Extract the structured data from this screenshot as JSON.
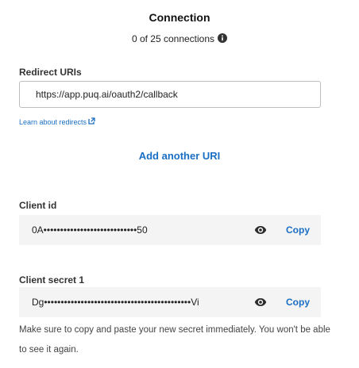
{
  "header": {
    "title": "Connection",
    "count_text": "0 of 25 connections",
    "info_icon": "info-circle-icon"
  },
  "redirect": {
    "label": "Redirect URIs",
    "uri_value": "https://app.puq.ai/oauth2/callback",
    "learn_link": "Learn about redirects",
    "external_icon": "external-link-icon",
    "add_another": "Add another URI"
  },
  "client_id": {
    "label": "Client id",
    "masked_value": "0A••••••••••••••••••••••••••••50",
    "reveal_icon": "eye-icon",
    "copy_label": "Copy"
  },
  "client_secret": {
    "label": "Client secret 1",
    "masked_value": "Dg••••••••••••••••••••••••••••••••••••••••••••Vi",
    "reveal_icon": "eye-icon",
    "copy_label": "Copy"
  },
  "note": "Make sure to copy and paste your new secret immediately. You won't be able to see it again.",
  "colors": {
    "link_blue": "#1a6fc4",
    "field_bg": "#f4f4f4",
    "text_dark": "#1a1a1a"
  }
}
